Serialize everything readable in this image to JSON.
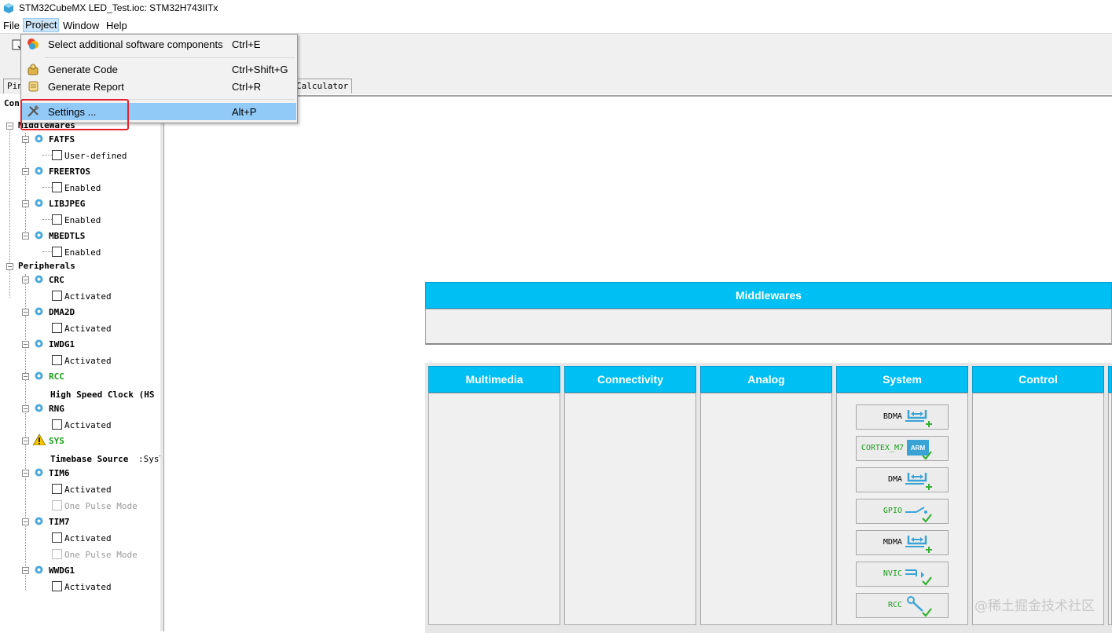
{
  "window": {
    "title": "STM32CubeMX LED_Test.ioc: STM32H743IITx"
  },
  "menubar": {
    "items": [
      "File",
      "Project",
      "Window",
      "Help"
    ]
  },
  "project_menu": {
    "items": [
      {
        "label": "Select additional software components",
        "shortcut": "Ctrl+E",
        "icon": "components-icon"
      },
      {
        "label": "Generate Code",
        "shortcut": "Ctrl+Shift+G",
        "icon": "generate-code-icon"
      },
      {
        "label": "Generate Report",
        "shortcut": "Ctrl+R",
        "icon": "report-scroll-icon"
      },
      {
        "label": "Settings ...",
        "shortcut": "Alt+P",
        "icon": "tools-icon",
        "highlighted": true
      }
    ]
  },
  "tabs": {
    "first": "Pin",
    "last": "Calculator"
  },
  "tree": {
    "root_fragment": "Con",
    "middlewares_label": "MiddleWares",
    "middlewares": [
      {
        "name": "FATFS",
        "option": "User-defined"
      },
      {
        "name": "FREERTOS",
        "option": "Enabled"
      },
      {
        "name": "LIBJPEG",
        "option": "Enabled"
      },
      {
        "name": "MBEDTLS",
        "option": "Enabled"
      }
    ],
    "peripherals_label": "Peripherals",
    "peripherals": [
      {
        "name": "CRC",
        "option": "Activated"
      },
      {
        "name": "DMA2D",
        "option": "Activated"
      },
      {
        "name": "IWDG1",
        "option": "Activated"
      },
      {
        "name": "RCC",
        "child_label": "High Speed Clock (HS"
      },
      {
        "name": "RNG",
        "option": "Activated"
      },
      {
        "name": "SYS",
        "child_label": "Timebase Source",
        "child_value": ":SysT:"
      },
      {
        "name": "TIM6",
        "option": "Activated",
        "option2": "One Pulse Mode"
      },
      {
        "name": "TIM7",
        "option": "Activated",
        "option2": "One Pulse Mode"
      },
      {
        "name": "WWDG1",
        "option": "Activated"
      }
    ]
  },
  "main": {
    "middlewares_header": "Middlewares",
    "categories": [
      "Multimedia",
      "Connectivity",
      "Analog",
      "System",
      "Control"
    ],
    "system_peripherals": [
      {
        "label": "BDMA",
        "icon": "dma-add-icon",
        "configured": false
      },
      {
        "label": "CORTEX_M7",
        "icon": "arm-icon",
        "configured": true
      },
      {
        "label": "DMA",
        "icon": "dma-add-icon",
        "configured": false
      },
      {
        "label": "GPIO",
        "icon": "gpio-check-icon",
        "configured": true
      },
      {
        "label": "MDMA",
        "icon": "dma-add-icon",
        "configured": false
      },
      {
        "label": "NVIC",
        "icon": "nvic-check-icon",
        "configured": true
      },
      {
        "label": "RCC",
        "icon": "wrench-check-icon",
        "configured": true
      }
    ]
  },
  "watermark": "@稀土掘金技术社区",
  "colors": {
    "category_header": "#00bff3",
    "menu_highlight": "#91c9f7",
    "annotation_box": "#e8212a",
    "configured_text": "#1a9e1a"
  }
}
